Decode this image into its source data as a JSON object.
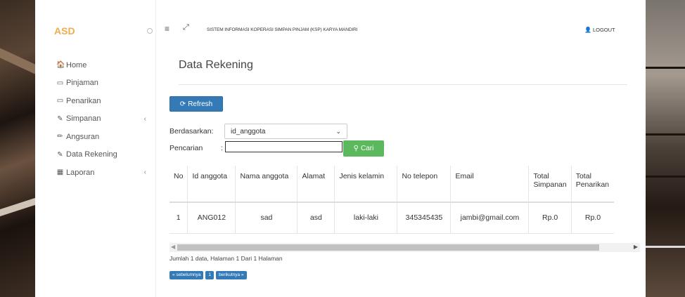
{
  "sidebar": {
    "brand": "ASD",
    "items": [
      {
        "label": "Home",
        "icon": "home-icon",
        "glyph": "🏠",
        "has_children": false
      },
      {
        "label": "Pinjaman",
        "icon": "credit-card-icon",
        "glyph": "▭",
        "has_children": false
      },
      {
        "label": "Penarikan",
        "icon": "credit-card-icon",
        "glyph": "▭",
        "has_children": false
      },
      {
        "label": "Simpanan",
        "icon": "edit-icon",
        "glyph": "✎",
        "has_children": true
      },
      {
        "label": "Angsuran",
        "icon": "pencil-icon",
        "glyph": "✏",
        "has_children": false
      },
      {
        "label": "Data Rekening",
        "icon": "edit-icon",
        "glyph": "✎",
        "has_children": false
      },
      {
        "label": "Laporan",
        "icon": "calendar-icon",
        "glyph": "▦",
        "has_children": true
      }
    ],
    "chevron": "‹"
  },
  "topbar": {
    "menu_glyph": "≡",
    "expand_glyph": "⤢",
    "title": "SISTEM INFORMASI KOPERASI SIMPAN PINJAM (KSP) KARYA MANDIRI",
    "logout_label": "LOGOUT"
  },
  "page": {
    "title": "Data Rekening",
    "refresh_label": "Refresh",
    "filter_label": "Berdasarkan:",
    "filter_value": "id_anggota",
    "search_label": "Pencarian",
    "search_colon": ":",
    "search_value": "",
    "search_button": "Cari"
  },
  "table": {
    "headers": [
      "No",
      "Id anggota",
      "Nama anggota",
      "Alamat",
      "Jenis kelamin",
      "No telepon",
      "Email",
      "Total Simpanan",
      "Total Penarikan"
    ],
    "rows": [
      [
        "1",
        "ANG012",
        "sad",
        "asd",
        "laki-laki",
        "345345435",
        "jambi@gmail.com",
        "Rp.0",
        "Rp.0"
      ]
    ]
  },
  "footer": {
    "summary": "Jumlah 1 data, Halaman 1 Dari 1 Halaman",
    "prev_label": "« sebelumnya",
    "page_label": "1",
    "next_label": "berikutnya »"
  },
  "colors": {
    "brand": "#f0ad4e",
    "primary": "#337ab7",
    "success": "#5cb85c"
  }
}
